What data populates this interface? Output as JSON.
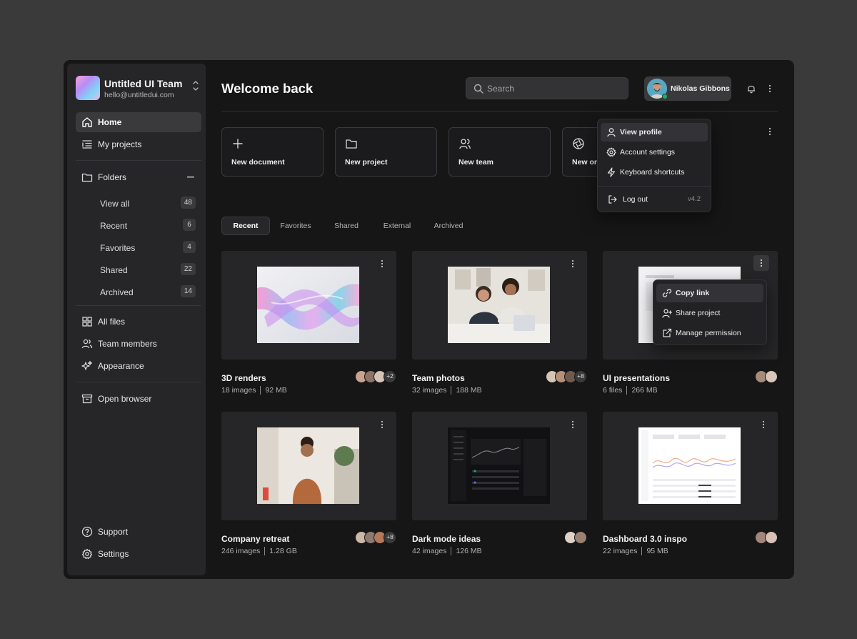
{
  "team": {
    "name": "Untitled UI Team",
    "email": "hello@untitledui.com"
  },
  "nav": {
    "home": "Home",
    "projects": "My projects",
    "folders": "Folders",
    "folder_items": [
      {
        "label": "View all",
        "count": "48"
      },
      {
        "label": "Recent",
        "count": "6"
      },
      {
        "label": "Favorites",
        "count": "4"
      },
      {
        "label": "Shared",
        "count": "22"
      },
      {
        "label": "Archived",
        "count": "14"
      }
    ],
    "all_files": "All files",
    "team_members": "Team members",
    "appearance": "Appearance",
    "open_browser": "Open browser",
    "support": "Support",
    "settings": "Settings"
  },
  "header": {
    "title": "Welcome back",
    "search_placeholder": "Search",
    "user_name": "Nikolas Gibbons"
  },
  "quick_actions": [
    "New document",
    "New project",
    "New team",
    "New organization"
  ],
  "tabs": [
    "Recent",
    "Favorites",
    "Shared",
    "External",
    "Archived"
  ],
  "profile_menu": {
    "view_profile": "View profile",
    "account_settings": "Account settings",
    "keyboard_shortcuts": "Keyboard shortcuts",
    "log_out": "Log out",
    "version": "v4.2"
  },
  "card_menu": {
    "copy_link": "Copy link",
    "share_project": "Share project",
    "manage_permission": "Manage permission"
  },
  "cards": [
    {
      "title": "3D renders",
      "count": "18 images",
      "size": "92 MB",
      "extra": "+2"
    },
    {
      "title": "Team photos",
      "count": "32 images",
      "size": "188 MB",
      "extra": "+8"
    },
    {
      "title": "UI presentations",
      "count": "6 files",
      "size": "266 MB",
      "extra": ""
    },
    {
      "title": "Company retreat",
      "count": "246 images",
      "size": "1.28 GB",
      "extra": "+8"
    },
    {
      "title": "Dark mode ideas",
      "count": "42 images",
      "size": "126 MB",
      "extra": ""
    },
    {
      "title": "Dashboard 3.0 inspo",
      "count": "22 images",
      "size": "95 MB",
      "extra": ""
    }
  ],
  "colors": {
    "app_bg": "#161617",
    "sidebar_bg": "#262628",
    "online": "#17b26a",
    "backdrop": "#3a3a3a"
  }
}
